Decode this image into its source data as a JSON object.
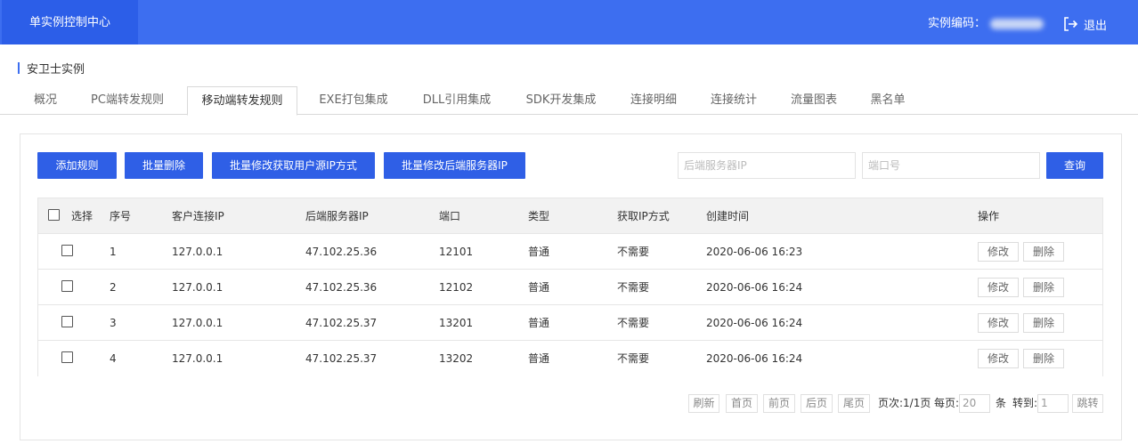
{
  "header": {
    "brand": "单实例控制中心",
    "instance_label": "实例编码：",
    "logout_label": "退出",
    "logout_icon": "logout-icon"
  },
  "section": {
    "title": "安卫士实例"
  },
  "tabs": [
    {
      "label": "概况"
    },
    {
      "label": "PC端转发规则"
    },
    {
      "label": "移动端转发规则",
      "active": true
    },
    {
      "label": "EXE打包集成"
    },
    {
      "label": "DLL引用集成"
    },
    {
      "label": "SDK开发集成"
    },
    {
      "label": "连接明细"
    },
    {
      "label": "连接统计"
    },
    {
      "label": "流量图表"
    },
    {
      "label": "黑名单"
    }
  ],
  "toolbar": {
    "add_rule": "添加规则",
    "batch_delete": "批量删除",
    "batch_modify_ip_method": "批量修改获取用户源IP方式",
    "batch_modify_backend_ip": "批量修改后端服务器IP",
    "backend_ip_placeholder": "后端服务器IP",
    "port_placeholder": "端口号",
    "query": "查询"
  },
  "table": {
    "headers": {
      "select": "选择",
      "index": "序号",
      "client_ip": "客户连接IP",
      "backend_ip": "后端服务器IP",
      "port": "端口",
      "type": "类型",
      "ip_method": "获取IP方式",
      "created": "创建时间",
      "actions": "操作"
    },
    "rows": [
      {
        "index": "1",
        "client_ip": "127.0.0.1",
        "backend_ip": "47.102.25.36",
        "port": "12101",
        "type": "普通",
        "ip_method": "不需要",
        "created": "2020-06-06 16:23",
        "edit": "修改",
        "delete": "删除"
      },
      {
        "index": "2",
        "client_ip": "127.0.0.1",
        "backend_ip": "47.102.25.36",
        "port": "12102",
        "type": "普通",
        "ip_method": "不需要",
        "created": "2020-06-06 16:24",
        "edit": "修改",
        "delete": "删除"
      },
      {
        "index": "3",
        "client_ip": "127.0.0.1",
        "backend_ip": "47.102.25.37",
        "port": "13201",
        "type": "普通",
        "ip_method": "不需要",
        "created": "2020-06-06 16:24",
        "edit": "修改",
        "delete": "删除"
      },
      {
        "index": "4",
        "client_ip": "127.0.0.1",
        "backend_ip": "47.102.25.37",
        "port": "13202",
        "type": "普通",
        "ip_method": "不需要",
        "created": "2020-06-06 16:24",
        "edit": "修改",
        "delete": "删除"
      }
    ]
  },
  "pagination": {
    "refresh": "刷新",
    "first": "首页",
    "prev": "前页",
    "next": "后页",
    "last": "尾页",
    "page_info": "页次:1/1页",
    "per_page_label": "每页:",
    "per_page_value": "20",
    "per_page_unit": "条",
    "goto_label": "转到:",
    "goto_value": "1",
    "jump": "跳转"
  },
  "colors": {
    "primary": "#3d6ef0",
    "button": "#2f5fe6"
  }
}
